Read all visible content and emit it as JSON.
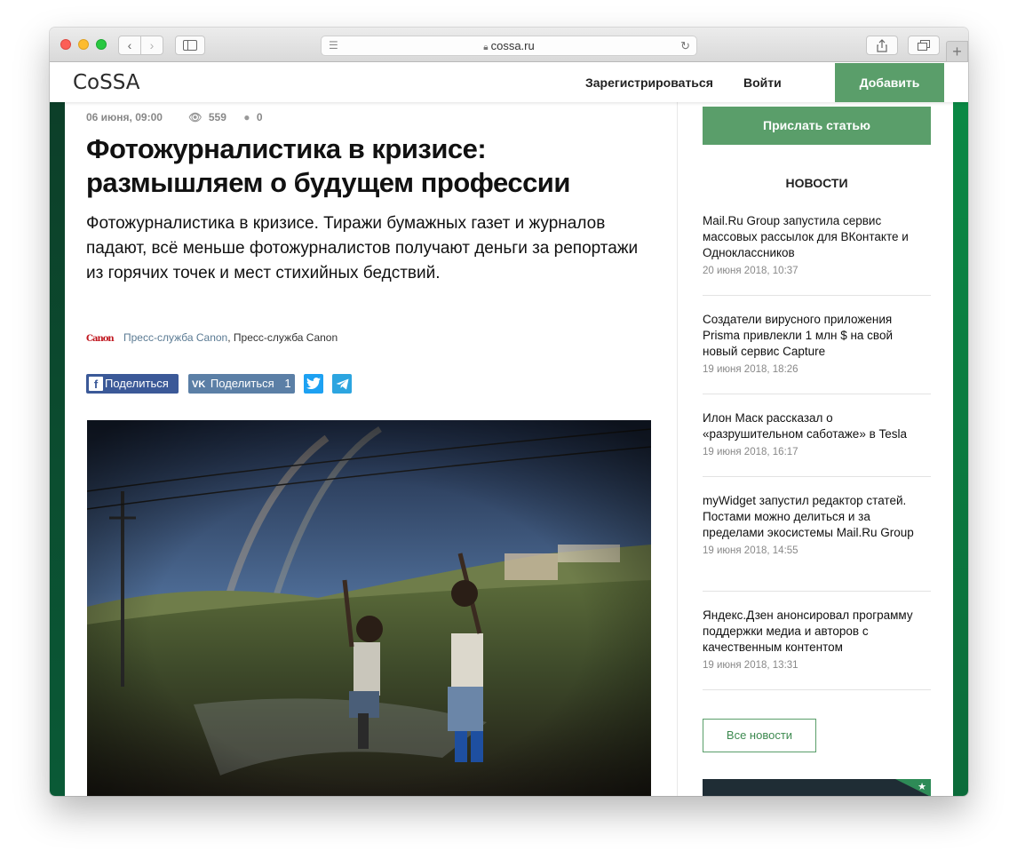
{
  "browser": {
    "url": "cossa.ru",
    "nav_back": "‹",
    "nav_forward": "›",
    "new_tab": "+"
  },
  "header": {
    "logo": "CoSSA",
    "register": "Зарегистрироваться",
    "login": "Войти",
    "add": "Добавить"
  },
  "article": {
    "date": "06 июня, 09:00",
    "views": "559",
    "comments": "0",
    "title": "Фотожурналистика в кризисе: размышляем о будущем профессии",
    "lead": "Фотожурналистика в кризисе. Тиражи бумажных газет и журналов падают, всё меньше фотожурналистов получают деньги за репортажи из горячих точек и мест стихийных бедствий.",
    "author_logo": "Canon",
    "author_link": "Пресс-служба Canon",
    "author_sep": ",",
    "author_name": "Пресс-служба Canon",
    "share": {
      "fb_label": "Поделиться",
      "vk_label": "Поделиться",
      "vk_count": "1"
    }
  },
  "aside": {
    "send_article": "Прислать статью",
    "news_heading": "НОВОСТИ",
    "news": [
      {
        "title": "Mail.Ru Group запустила сервис массовых рассылок для ВКонтакте и Одноклассников",
        "date": "20 июня 2018, 10:37"
      },
      {
        "title": "Создатели вирусного приложения Prisma привлекли 1 млн $ на свой новый сервис Capture",
        "date": "19 июня 2018, 18:26"
      },
      {
        "title": "Илон Маск рассказал о «разрушительном саботаже» в Tesla",
        "date": "19 июня 2018, 16:17"
      },
      {
        "title": "myWidget запустил редактор статей. Постами можно делиться и за пределами экосистемы Mail.Ru Group",
        "date": "19 июня 2018, 14:55"
      },
      {
        "title": "Яндекс.Дзен анонсировал программу поддержки медиа и авторов с качественным контентом",
        "date": "19 июня 2018, 13:31"
      }
    ],
    "all_news": "Все новости"
  }
}
